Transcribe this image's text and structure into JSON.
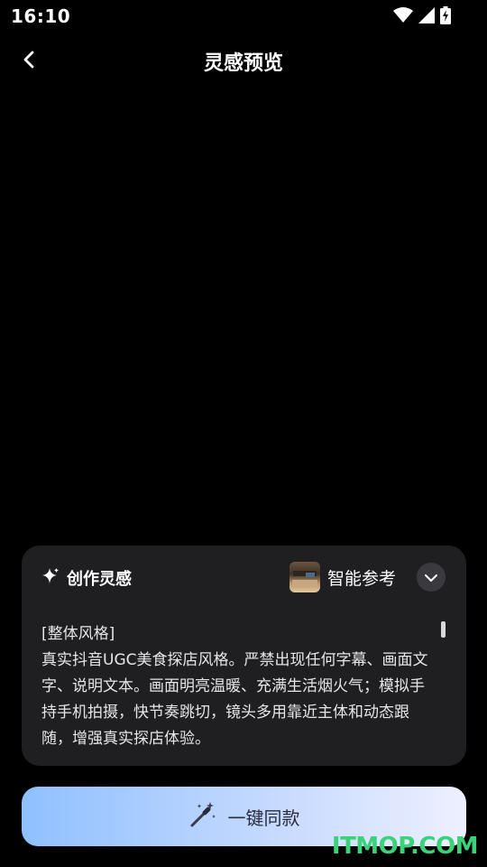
{
  "status_bar": {
    "time": "16:10",
    "icons": [
      "wifi-icon",
      "signal-icon",
      "battery-charging-icon"
    ]
  },
  "header": {
    "back_icon": "chevron-left-icon",
    "title": "灵感预览"
  },
  "card": {
    "title_icon": "sparkle-icon",
    "title": "创作灵感",
    "reference_label": "智能参考",
    "expand_icon": "chevron-down-icon",
    "text_heading": "[整体风格]",
    "text_body": "真实抖音UGC美食探店风格。严禁出现任何字幕、画面文字、说明文本。画面明亮温暖、充满生活烟火气；模拟手持手机拍摄，快节奏跳切，镜头多用靠近主体和动态跟随，增强真实探店体验。"
  },
  "action": {
    "icon": "magic-wand-icon",
    "label": "一键同款"
  },
  "watermark": "ITMOP.COM",
  "colors": {
    "background": "#000000",
    "card": "#1f1f22",
    "button_gradient_start": "#8fc0ff",
    "button_gradient_end": "#eef0ff",
    "watermark": "#3bd27a"
  }
}
